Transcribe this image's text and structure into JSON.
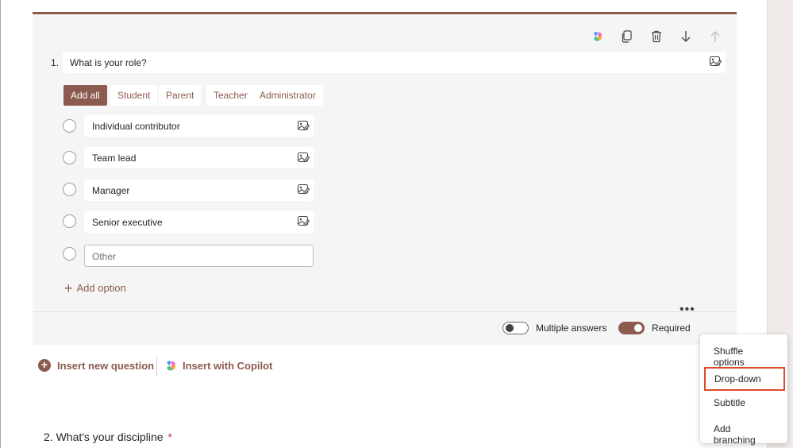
{
  "question1": {
    "number": "1.",
    "title": "What is your role?",
    "chips": [
      "Add all",
      "Student",
      "Parent",
      "Teacher",
      "Administrator"
    ],
    "options": [
      "Individual contributor",
      "Team lead",
      "Manager",
      "Senior executive"
    ],
    "other_placeholder": "Other",
    "add_option_label": "Add option",
    "multiple_answers_label": "Multiple answers",
    "multiple_answers_on": false,
    "required_label": "Required",
    "required_on": true
  },
  "toolbar": {
    "icons": [
      "copilot-icon",
      "copy-icon",
      "delete-icon",
      "move-down-icon",
      "move-up-icon"
    ]
  },
  "insert": {
    "new_question_label": "Insert new question",
    "copilot_label": "Insert with Copilot"
  },
  "more_menu": {
    "items": [
      "Shuffle options",
      "Drop-down",
      "Subtitle",
      "Add branching"
    ],
    "highlighted": "Drop-down"
  },
  "question2": {
    "title": "2. What's your discipline",
    "required_marker": "*"
  },
  "colors": {
    "accent": "#8c5a4e",
    "highlight": "#e0482c",
    "required": "#c4314b"
  }
}
